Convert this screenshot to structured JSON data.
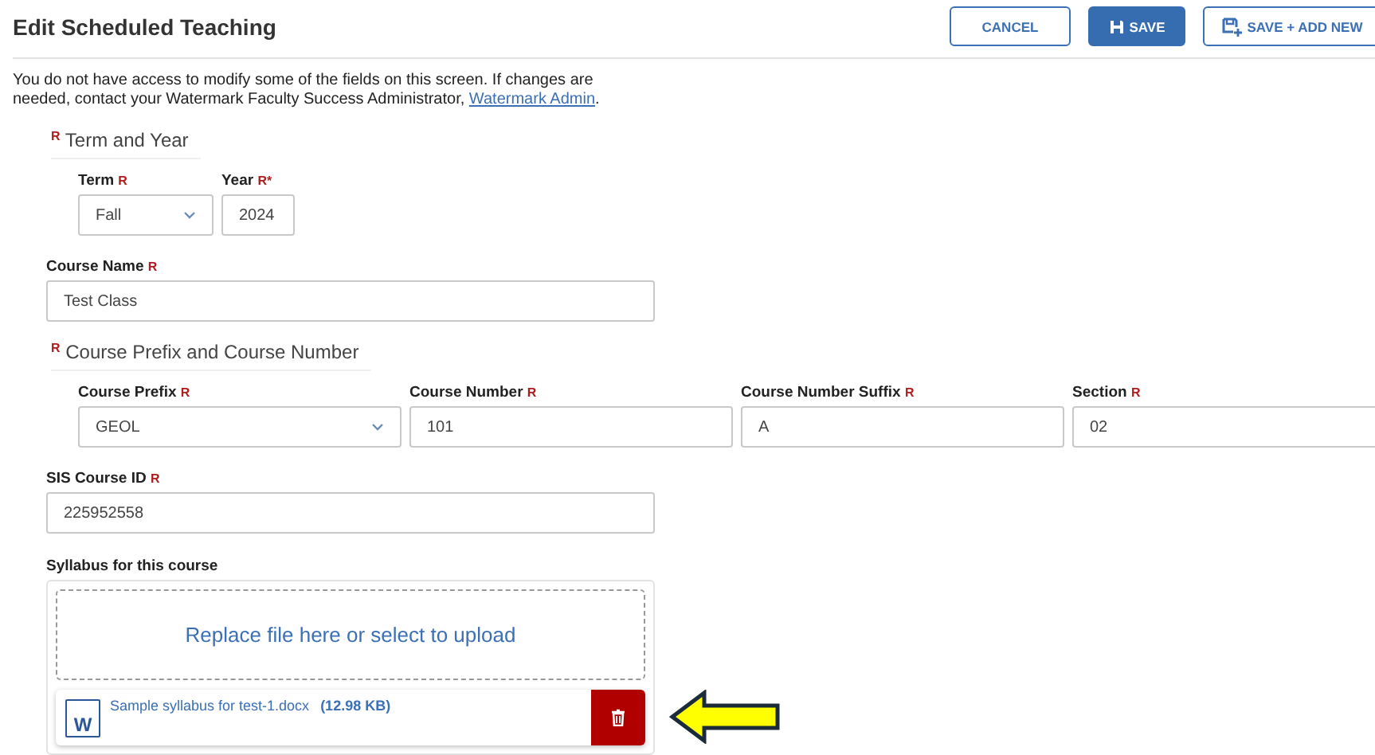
{
  "header": {
    "title": "Edit Scheduled Teaching",
    "buttons": [
      {
        "label": "CANCEL",
        "kind": "outline"
      },
      {
        "label": "SAVE",
        "kind": "primary"
      },
      {
        "label": "SAVE + ADD NEW",
        "kind": "add"
      }
    ]
  },
  "notice": {
    "text": "You do not have access to modify some of the fields on this screen. If changes are needed, contact your Watermark Faculty Success Administrator, ",
    "link": "Watermark Admin",
    "after": "."
  },
  "groups": [
    {
      "kind": "fieldset",
      "legend": "Term and Year",
      "legend_mark": "R",
      "fields": [
        {
          "label": "Term",
          "mark": "R",
          "kind": "select",
          "value": "Fall"
        },
        {
          "label": "Year",
          "mark": "R",
          "asterisk": "*",
          "kind": "text",
          "value": "2024"
        }
      ]
    },
    {
      "kind": "single",
      "fields": [
        {
          "label": "Course Name",
          "mark": "R",
          "kind": "text",
          "value": "Test Class"
        }
      ]
    },
    {
      "kind": "fieldset",
      "legend": "Course Prefix and Course Number",
      "legend_mark": "R",
      "fields": [
        {
          "label": "Course Prefix",
          "mark": "R",
          "kind": "select",
          "value": "GEOL"
        },
        {
          "label": "Course Number",
          "mark": "R",
          "kind": "text",
          "value": "101"
        },
        {
          "label": "Course Number Suffix",
          "mark": "R",
          "kind": "text",
          "value": "A"
        },
        {
          "label": "Section",
          "mark": "R",
          "kind": "text",
          "value": "02"
        }
      ]
    },
    {
      "kind": "single",
      "fields": [
        {
          "label": "SIS Course ID",
          "mark": "R",
          "kind": "text",
          "value": "225952558"
        }
      ]
    }
  ],
  "upload": {
    "label": "Syllabus for this course",
    "dropzone": "Replace file here or select to upload",
    "file": {
      "icon_letter": "W",
      "name": "Sample syllabus for test-1.docx",
      "size": "(12.98 KB)"
    }
  }
}
